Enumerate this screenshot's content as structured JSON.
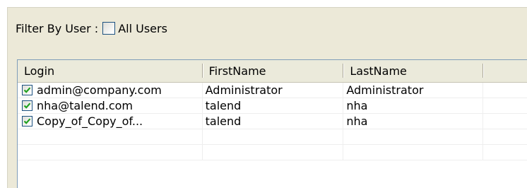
{
  "filter": {
    "label": "Filter By User :",
    "all_users_label": "All Users",
    "all_users_checked": false
  },
  "table": {
    "columns": [
      "Login",
      "FirstName",
      "LastName"
    ],
    "rows": [
      {
        "checked": true,
        "login": "admin@company.com",
        "first": "Administrator",
        "last": "Administrator"
      },
      {
        "checked": true,
        "login": "nha@talend.com",
        "first": "talend",
        "last": "nha"
      },
      {
        "checked": true,
        "login": "Copy_of_Copy_of...",
        "first": "talend",
        "last": "nha"
      }
    ]
  },
  "colors": {
    "panel_bg": "#ece9d8",
    "check_mark": "#21a121",
    "checkbox_border": "#1c5180",
    "table_border": "#7f9db9"
  }
}
